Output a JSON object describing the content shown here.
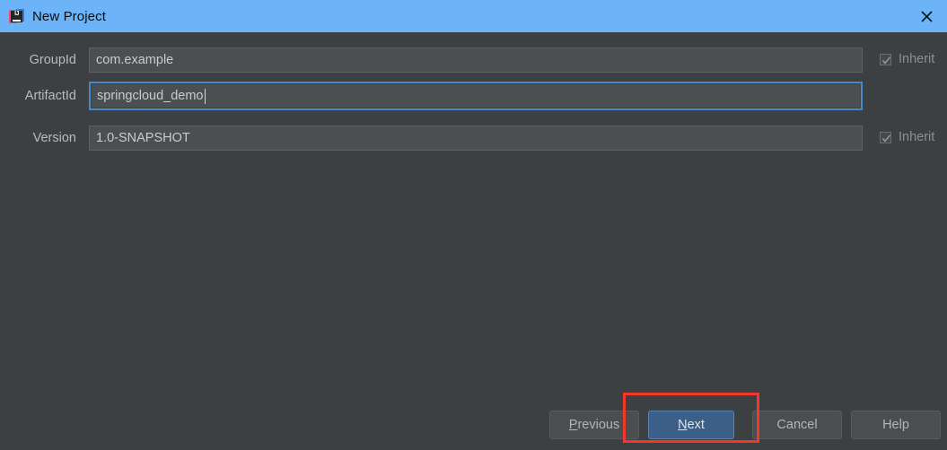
{
  "window": {
    "title": "New Project",
    "app_icon": "intellij-idea-icon",
    "icon_text": "IJ",
    "close_icon": "close-icon",
    "titlebar_color": "#6cb3f7",
    "background_color": "#3c4042"
  },
  "form": {
    "rows": [
      {
        "label": "GroupId",
        "value": "com.example",
        "focused": false,
        "inherit": {
          "label": "Inherit",
          "checked": true,
          "enabled": false
        }
      },
      {
        "label": "ArtifactId",
        "value": "springcloud_demo",
        "focused": true,
        "inherit": null
      },
      {
        "label": "Version",
        "value": "1.0-SNAPSHOT",
        "focused": false,
        "inherit": {
          "label": "Inherit",
          "checked": true,
          "enabled": false
        }
      }
    ]
  },
  "buttons": {
    "previous": {
      "label": "Previous",
      "mnemonic": "P",
      "primary": false
    },
    "next": {
      "label": "Next",
      "mnemonic": "N",
      "primary": true,
      "accent_color": "#3b5f89"
    },
    "cancel": {
      "label": "Cancel",
      "mnemonic": "",
      "primary": false
    },
    "help": {
      "label": "Help",
      "mnemonic": "",
      "primary": false
    }
  },
  "annotation": {
    "target": "next-button",
    "color": "#f3372a"
  }
}
